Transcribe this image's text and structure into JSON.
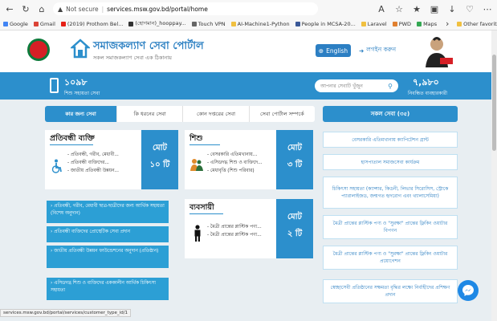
{
  "browser": {
    "not_secure": "Not secure",
    "url": "services.msw.gov.bd/portal/home",
    "bookmarks": [
      "Google",
      "Gmail",
      "(2019) Prothom Bel...",
      "(হোগমান)_hooppay...",
      "Touch VPN",
      "AI-Machine1-Python",
      "People in MCSA-20...",
      "Laravel",
      "PWD",
      "Maps"
    ],
    "other_favorites": "Other favorites"
  },
  "header": {
    "title": "সমাজকল্যাণ সেবা পোর্টাল",
    "subtitle": "সকল সমাজকল্যাণ সেবা এক ঠিকানায়",
    "lang": "English",
    "login": "লগইন করুন"
  },
  "band": {
    "hotline_num": "১০৯৮",
    "hotline_lbl": "শিশু সহায়তা সেবা",
    "search_placeholder": "আপনার সেবাটি খুঁজুন",
    "reg_num": "৭,৯৮০",
    "reg_lbl": "নিবন্ধিত ব্যবহারকারী"
  },
  "tabs": [
    "কার জন্য সেবা",
    "কি ধরনের সেবা",
    "কোন দপ্তরের সেবা",
    "সেবা পোর্টাল সম্পর্কে"
  ],
  "all_services": "সকল সেবা (৩৫)",
  "cards": {
    "disabled": {
      "title": "প্রতিবন্ধী ব্যক্তি",
      "items": [
        "- প্রতিবন্ধী, গরীব, মেধাবী...",
        "- প্রতিবন্ধী ব্যক্তিদের...",
        "- জাতীয় প্রতিবন্ধী উন্নয়ন..."
      ],
      "total_l1": "মোট",
      "total_l2": "১০ টি"
    },
    "child": {
      "title": "শিশু",
      "items": [
        "- বেসরকারি এতিমখানায়...",
        "- এসিডদগ্ধ শিশু ও ব্যক্তিদে...",
        "- মেধাবৃত্তি (শিশু পরিবার)"
      ],
      "total_l1": "মোট",
      "total_l2": "৩ টি"
    },
    "business": {
      "title": "ব্যবসায়ী",
      "items": [
        "- মৈত্রী প্রান্তের প্লাস্টিক পণ্য...",
        "- মৈত্রী প্রান্তের প্লাস্টিক পণ্য..."
      ],
      "total_l1": "মোট",
      "total_l2": "২ টি"
    }
  },
  "service_buttons": [
    "› প্রতিবন্ধী, গরীব, মেধাবী ছাত্র-ছাত্রীদের জন্য আর্থিক সহায়তা (বিশেষ অনুদান)",
    "› প্রতিবন্ধী ব্যক্তিদের প্রোস্থেটিক সেবা প্রদান",
    "› জাতীয় প্রতিবন্ধী উন্নয়ন ফাউন্ডেশনের অনুদান (প্রতিষ্ঠান)",
    "› এসিডদগ্ধ শিশু ও ব্যক্তিদের এককালীন আর্থিক চিকিৎসা সহায়তা"
  ],
  "right_list": [
    "বেসরকারি এতিমখানায় ক্যাপিটেশন গ্রান্ট",
    "হাসপাতাল সমাজসেবা কার্যক্রম",
    "চিকিৎসা সহায়তা (ক্যান্সার, কিডনী, লিভার সিরোসিস, স্ট্রোকে প্যারালাইজড, জন্মগত হৃদরোগ এবং থ্যালাসেমিয়া)",
    "মৈত্রী প্রান্তের প্লাস্টিক পণ্য ও \"সুরক্ষা\" প্রান্তের ফ্লিকিং ওয়াটার বিপণন",
    "মৈত্রী প্রান্তের প্লাস্টিক পণ্য ও \"সুরক্ষা\" প্রান্তের ফ্লিকিং ওয়াটার প্রয়োগেশন",
    "স্বেচ্ছাসেবী প্রতিষ্ঠানের সক্ষমতা বৃদ্ধির লক্ষ্যে নির্বাহীদের প্রশিক্ষণ প্রদান"
  ],
  "status_url": "services.msw.gov.bd/portal/services/customer_type_id/1"
}
